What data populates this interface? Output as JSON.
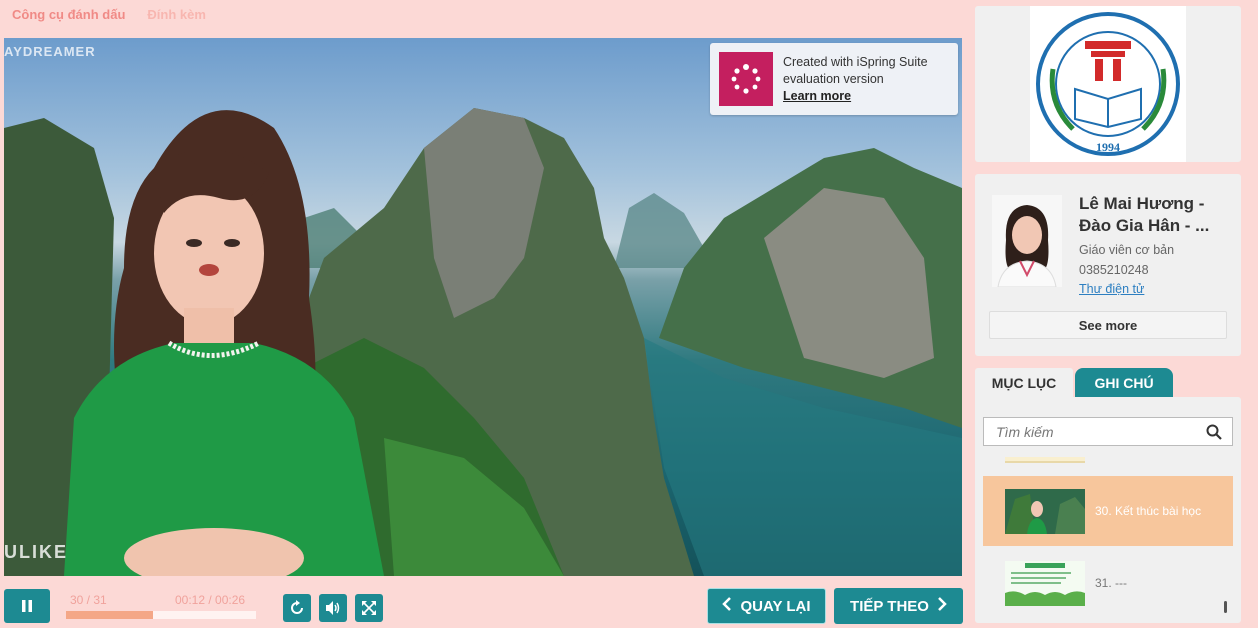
{
  "top_tabs": {
    "markup_tools": "Công cụ đánh dấu",
    "attachments": "Đính kèm"
  },
  "video": {
    "watermark_top": "AYDREAMER",
    "watermark_bottom": "ULIKE",
    "ispring": {
      "line1": "Created with iSpring Suite",
      "line2": "evaluation version",
      "learn_more": "Learn more"
    }
  },
  "player": {
    "slide_counter": "30 / 31",
    "time": "00:12 / 00:26",
    "progress": 0.46,
    "prev_label": "QUAY LẠI",
    "next_label": "TIẾP THEO"
  },
  "author": {
    "name": "Lê Mai Hương - Đào Gia Hân - ...",
    "role": "Giáo viên cơ bản",
    "phone": "0385210248",
    "email_link": "Thư điện tử",
    "see_more": "See more"
  },
  "school_logo": {
    "year": "1994"
  },
  "sidebar_tabs": {
    "contents": "MỤC LỤC",
    "notes": "GHI CHÚ"
  },
  "toc": {
    "search_placeholder": "Tìm kiếm",
    "items": [
      {
        "label": "30. Kết thúc bài học",
        "active": true
      },
      {
        "label": "31. ---",
        "active": false
      }
    ]
  },
  "colors": {
    "accent": "#1d8a92",
    "background": "#fcd9d6",
    "active_item": "#f7c69c",
    "ispring_brand": "#c41f5f"
  }
}
